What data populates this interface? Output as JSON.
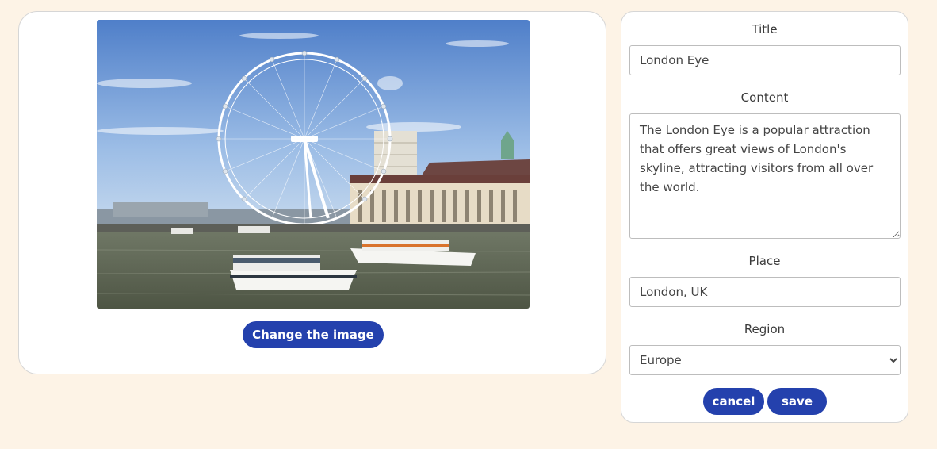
{
  "image_panel": {
    "change_button_label": "Change the image",
    "photo_subject": "London Eye ferris wheel by the river with boats and buildings"
  },
  "form": {
    "title_label": "Title",
    "title_value": "London Eye",
    "content_label": "Content",
    "content_value": "The London Eye is a popular attraction that offers great views of London's skyline, attracting visitors from all over the world.",
    "place_label": "Place",
    "place_value": "London, UK",
    "region_label": "Region",
    "region_selected": "Europe",
    "cancel_label": "cancel",
    "save_label": "save"
  },
  "colors": {
    "background": "#fdf3e6",
    "button": "#2441ad"
  }
}
